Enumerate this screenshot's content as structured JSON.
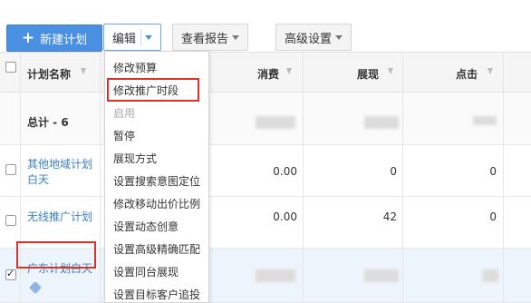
{
  "toolbar": {
    "new_plan": "新建计划",
    "edit": "编辑",
    "view_report": "查看报告",
    "advanced_settings": "高级设置"
  },
  "table": {
    "headers": {
      "plan_name": "计划名称",
      "spend": "消费",
      "impressions": "展现",
      "clicks": "点击"
    },
    "total_label": "总计 - 6",
    "rows": [
      {
        "name_line1": "其他地域计划",
        "name_line2": "白天",
        "spend": "0.00",
        "impressions": "0",
        "clicks": "0"
      },
      {
        "name_line1": "无线推广计划",
        "spend": "0.00",
        "impressions": "42",
        "clicks": "0"
      },
      {
        "name_line1": "广东计划白天"
      }
    ]
  },
  "edit_menu": {
    "items": [
      {
        "label": "修改预算"
      },
      {
        "label": "修改推广时段"
      },
      {
        "label": "启用"
      },
      {
        "label": "暂停"
      },
      {
        "label": "展现方式"
      },
      {
        "label": "设置搜索意图定位"
      },
      {
        "label": "修改移动出价比例"
      },
      {
        "label": "设置动态创意"
      },
      {
        "label": "设置高级精确匹配"
      },
      {
        "label": "设置同台展现"
      },
      {
        "label": "设置目标客户追投"
      }
    ]
  },
  "colors": {
    "primary": "#4a90e2",
    "link": "#3a7fc8",
    "highlight_box": "#d9342b",
    "selected_row": "#eef4fc"
  }
}
